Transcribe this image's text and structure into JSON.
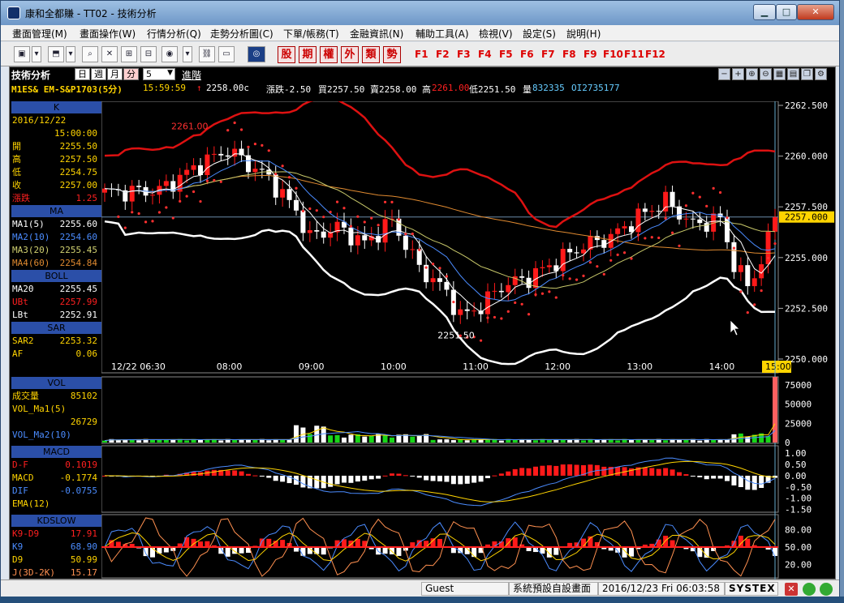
{
  "window": {
    "title": "康和全都賺 - TT02 - 技術分析",
    "minimize": "▁",
    "maximize": "□",
    "close": "✕"
  },
  "menu": [
    "畫面管理(M)",
    "畫面操作(W)",
    "行情分析(Q)",
    "走勢分析圖(C)",
    "下單/帳務(T)",
    "金融資訊(N)",
    "輔助工具(A)",
    "檢視(V)",
    "設定(S)",
    "說明(H)"
  ],
  "toolbar": {
    "red_buttons": [
      "股",
      "期",
      "權",
      "外",
      "類",
      "勢"
    ],
    "fkeys": [
      "F1",
      "F2",
      "F3",
      "F4",
      "F5",
      "F6",
      "F7",
      "F8",
      "F9",
      "F10",
      "F11",
      "F12"
    ]
  },
  "chart_header": {
    "title": "技術分析",
    "periods": [
      "日",
      "週",
      "月",
      "分"
    ],
    "active_period": "分",
    "interval": "5",
    "advanced": "進階"
  },
  "quote": {
    "symbol": "M1ES& EM-S&P1703(5分)",
    "time": "15:59:59",
    "arrow": "↑",
    "price": "2258.00c",
    "change": "漲跌-2.50",
    "bid": "買2257.50",
    "ask": "賣2258.00",
    "high_label": "高",
    "high": "2261.00",
    "low": "低2251.50",
    "vol_label": "量",
    "volume": "832335",
    "oi": "OI2735177"
  },
  "info": {
    "k": {
      "header": "K",
      "date": "2016/12/22",
      "time": "15:00:00",
      "rows": [
        {
          "label": "開",
          "value": "2255.50",
          "color": "#ffd400"
        },
        {
          "label": "高",
          "value": "2257.50",
          "color": "#ffd400"
        },
        {
          "label": "低",
          "value": "2254.75",
          "color": "#ffd400"
        },
        {
          "label": "收",
          "value": "2257.00",
          "color": "#ffd400"
        },
        {
          "label": "漲跌",
          "value": "1.25",
          "color": "#ff2020"
        }
      ]
    },
    "ma": {
      "header": "MA",
      "rows": [
        {
          "label": "MA1(5)",
          "value": "2255.60",
          "color": "#ffffff"
        },
        {
          "label": "MA2(10)",
          "value": "2254.60",
          "color": "#4b8cff"
        },
        {
          "label": "MA3(20)",
          "value": "2255.45",
          "color": "#d0d070"
        },
        {
          "label": "MA4(60)",
          "value": "2254.84",
          "color": "#e08a30"
        }
      ]
    },
    "boll": {
      "header": "BOLL",
      "rows": [
        {
          "label": "MA20",
          "value": "2255.45",
          "color": "#ffffff"
        },
        {
          "label": "UBt",
          "value": "2257.99",
          "color": "#ff2020"
        },
        {
          "label": "LBt",
          "value": "2252.91",
          "color": "#ffffff"
        }
      ]
    },
    "sar": {
      "header": "SAR",
      "rows": [
        {
          "label": "SAR2",
          "value": "2253.32",
          "color": "#ffd400"
        },
        {
          "label": "AF",
          "value": "0.06",
          "color": "#ffd400"
        }
      ]
    },
    "vol": {
      "header": "VOL",
      "rows": [
        {
          "label": "成交量",
          "value": "85102",
          "color": "#ffd400"
        },
        {
          "label": "VOL_Ma1(5)",
          "value": "",
          "color": "#ffd400"
        },
        {
          "label": "",
          "value": "26729",
          "color": "#ffd400"
        },
        {
          "label": "VOL_Ma2(10)",
          "value": "",
          "color": "#4b8cff"
        }
      ]
    },
    "macd": {
      "header": "MACD",
      "rows": [
        {
          "label": "D-F",
          "value": "0.1019",
          "color": "#ff2020"
        },
        {
          "label": "MACD",
          "value": "-0.1774",
          "color": "#ffd400"
        },
        {
          "label": "DIF",
          "value": "-0.0755",
          "color": "#4b8cff"
        },
        {
          "label": "EMA(12)",
          "value": "",
          "color": "#ffd400"
        }
      ]
    },
    "kd": {
      "header": "KDSLOW",
      "rows": [
        {
          "label": "K9-D9",
          "value": "17.91",
          "color": "#ff2020"
        },
        {
          "label": "K9",
          "value": "68.90",
          "color": "#4b8cff"
        },
        {
          "label": "D9",
          "value": "50.99",
          "color": "#ffd400"
        },
        {
          "label": "J(3D-2K)",
          "value": "15.17",
          "color": "#ff9050"
        }
      ]
    }
  },
  "price_axis": {
    "ticks": [
      "2262.500",
      "2260.000",
      "2257.500",
      "2255.000",
      "2252.500",
      "2250.000"
    ],
    "current": "2257.000"
  },
  "time_axis": [
    "12/22 06:30",
    "08:00",
    "09:00",
    "10:00",
    "11:00",
    "12:00",
    "13:00",
    "14:00",
    "15:00"
  ],
  "annotations": {
    "high": "2261.00",
    "low": "2251.50"
  },
  "vol_axis": [
    "75000",
    "50000",
    "25000",
    "0"
  ],
  "macd_axis": [
    "1.00",
    "0.50",
    "0.00",
    "-0.50",
    "-1.00",
    "-1.50"
  ],
  "kd_axis": [
    "80.00",
    "50.00",
    "20.00"
  ],
  "status": {
    "user": "Guest",
    "layout": "系統預設自設畫面",
    "datetime": "2016/12/23 Fri 06:03:58",
    "brand": "SYSTEX"
  },
  "colors": {
    "up": "#ff1a1a",
    "down": "#ffffff",
    "ubt": "#dd1111",
    "lbt": "#ffffff",
    "sar": "#ff3030",
    "ma10": "#4b8cff",
    "ma20": "#c8c86a",
    "ma60": "#e08a30",
    "accent": "#ffd400"
  }
}
